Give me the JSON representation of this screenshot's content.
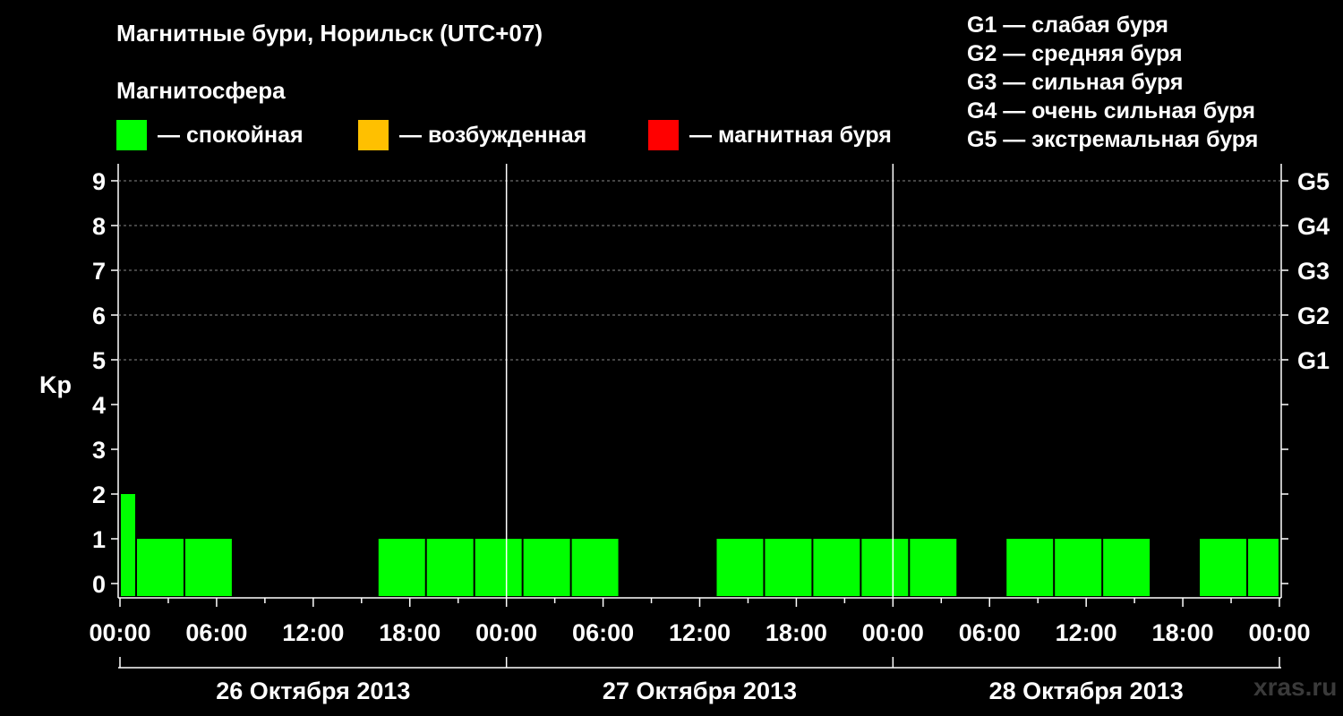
{
  "title": "Магнитные бури, Норильск (UTC+07)",
  "legend": {
    "heading": "Магнитосфера",
    "items": [
      {
        "label": "— спокойная",
        "color": "#00ff00"
      },
      {
        "label": "— возбужденная",
        "color": "#ffc000"
      },
      {
        "label": "— магнитная буря",
        "color": "#ff0000"
      }
    ]
  },
  "g_scale": [
    {
      "level": "G1",
      "kp": 5,
      "label": "G1 — слабая буря"
    },
    {
      "level": "G2",
      "kp": 6,
      "label": "G2 — средняя буря"
    },
    {
      "level": "G3",
      "kp": 7,
      "label": "G3 — сильная буря"
    },
    {
      "level": "G4",
      "kp": 8,
      "label": "G4 — очень сильная буря"
    },
    {
      "level": "G5",
      "kp": 9,
      "label": "G5 — экстремальная буря"
    }
  ],
  "watermark": "xras.ru",
  "chart_data": {
    "type": "bar",
    "ylabel": "Kp",
    "ylim": [
      0,
      9
    ],
    "yticks": [
      0,
      1,
      2,
      3,
      4,
      5,
      6,
      7,
      8,
      9
    ],
    "xticks": [
      "00:00",
      "06:00",
      "12:00",
      "18:00",
      "00:00",
      "06:00",
      "12:00",
      "18:00",
      "00:00",
      "06:00",
      "12:00",
      "18:00",
      "00:00"
    ],
    "days": [
      "26 Октября 2013",
      "27 Октября 2013",
      "28 Октября 2013"
    ],
    "interval_hours": 3,
    "series": [
      {
        "values": [
          2,
          1,
          1,
          0,
          0,
          0,
          1,
          1,
          1,
          1,
          1,
          0,
          0,
          1,
          1,
          1,
          1,
          1,
          0,
          1,
          1,
          1,
          0,
          1,
          1
        ]
      }
    ],
    "bar_offsets_hours": [
      0,
      1,
      4,
      7,
      10,
      13,
      16,
      19,
      22,
      25,
      28,
      31,
      34,
      37,
      40,
      43,
      46,
      49,
      52,
      55,
      58,
      61,
      64,
      67,
      70
    ],
    "bar_durations_hours": [
      1,
      3,
      3,
      3,
      3,
      3,
      3,
      3,
      3,
      3,
      3,
      3,
      3,
      3,
      3,
      3,
      3,
      3,
      3,
      3,
      3,
      3,
      3,
      3,
      2
    ],
    "bar_color": "#00ff00",
    "grid": true
  }
}
